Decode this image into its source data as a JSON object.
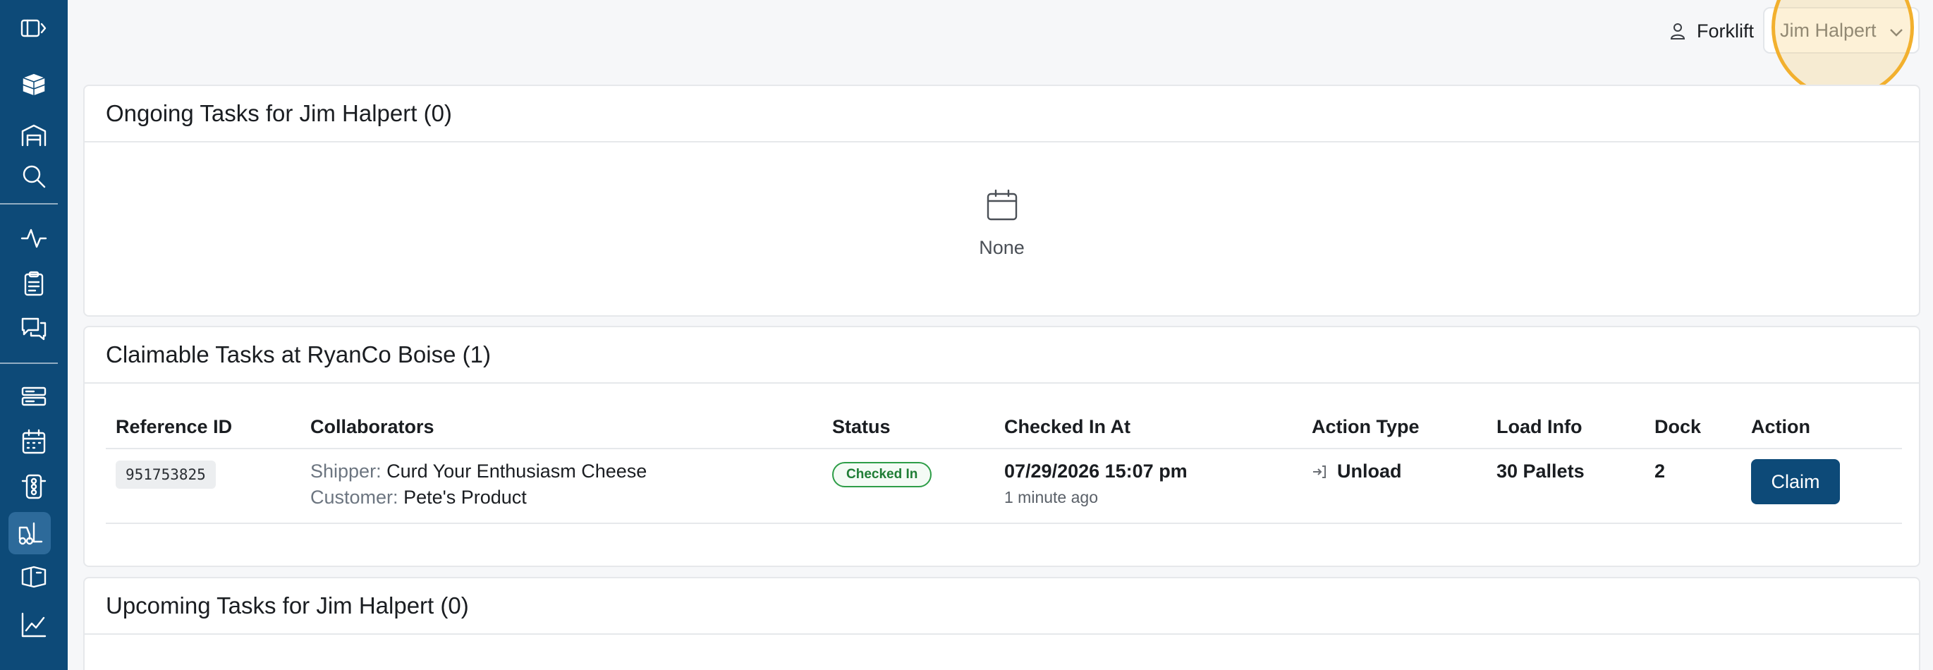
{
  "sidebar": {
    "items": [
      {
        "name": "sidebar-toggle",
        "icon": "sidebar-expand-icon"
      },
      {
        "name": "logo",
        "icon": "cube-logo-icon"
      },
      {
        "name": "warehouse",
        "icon": "warehouse-icon"
      },
      {
        "name": "search",
        "icon": "search-icon"
      },
      {
        "name": "activity",
        "icon": "activity-icon"
      },
      {
        "name": "tasks",
        "icon": "clipboard-icon"
      },
      {
        "name": "messages",
        "icon": "chat-icon"
      },
      {
        "name": "docks",
        "icon": "server-icon"
      },
      {
        "name": "calendar",
        "icon": "calendar-icon"
      },
      {
        "name": "dock-status",
        "icon": "traffic-light-icon"
      },
      {
        "name": "forklift",
        "icon": "forklift-icon",
        "active": true
      },
      {
        "name": "loads",
        "icon": "box-icon"
      },
      {
        "name": "analytics",
        "icon": "chart-icon"
      }
    ],
    "colors": {
      "background": "#0d4a78",
      "active": "#2d6a9a"
    }
  },
  "header": {
    "role": "Forklift",
    "user": "Jim Halpert"
  },
  "ongoing": {
    "title": "Ongoing Tasks for Jim Halpert (0)",
    "empty_text": "None"
  },
  "claimable": {
    "title": "Claimable Tasks at RyanCo Boise (1)",
    "columns": [
      "Reference ID",
      "Collaborators",
      "Status",
      "Checked In At",
      "Action Type",
      "Load Info",
      "Dock",
      "Action"
    ],
    "rows": [
      {
        "reference_id": "951753825",
        "shipper_label": "Shipper:",
        "shipper": "Curd Your Enthusiasm Cheese",
        "customer_label": "Customer:",
        "customer": "Pete's Product",
        "status": "Checked In",
        "checked_in_at": "07/29/2026 15:07 pm",
        "checked_in_ago": "1 minute ago",
        "action_type": "Unload",
        "load_info": "30 Pallets",
        "dock": "2",
        "action": "Claim"
      }
    ]
  },
  "upcoming": {
    "title": "Upcoming Tasks for Jim Halpert (0)"
  },
  "colors": {
    "brand": "#0d4a78",
    "status_green": "#2d9d47",
    "highlight": "#f2b02e"
  }
}
